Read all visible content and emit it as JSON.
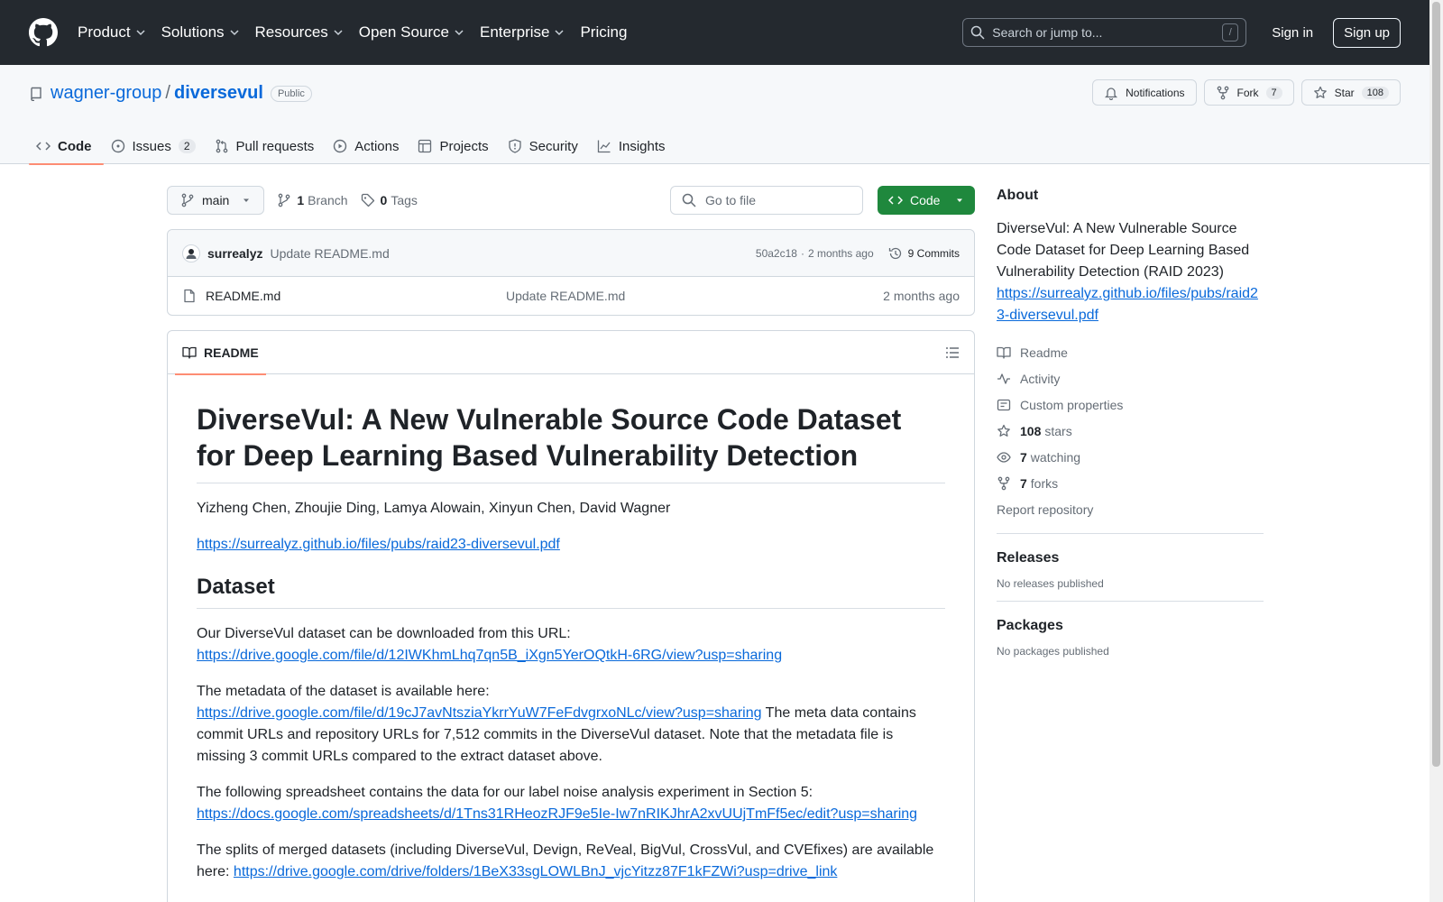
{
  "header": {
    "nav": [
      {
        "label": "Product",
        "has_menu": true
      },
      {
        "label": "Solutions",
        "has_menu": true
      },
      {
        "label": "Resources",
        "has_menu": true
      },
      {
        "label": "Open Source",
        "has_menu": true
      },
      {
        "label": "Enterprise",
        "has_menu": true
      },
      {
        "label": "Pricing",
        "has_menu": false
      }
    ],
    "search_placeholder": "Search or jump to...",
    "search_key": "/",
    "sign_in": "Sign in",
    "sign_up": "Sign up"
  },
  "repo": {
    "owner": "wagner-group",
    "separator": "/",
    "name": "diversevul",
    "visibility": "Public",
    "notifications_label": "Notifications",
    "fork_label": "Fork",
    "fork_count": "7",
    "star_label": "Star",
    "star_count": "108"
  },
  "tabs": [
    {
      "label": "Code",
      "icon": "code-icon",
      "active": true,
      "count": ""
    },
    {
      "label": "Issues",
      "icon": "issue-icon",
      "active": false,
      "count": "2"
    },
    {
      "label": "Pull requests",
      "icon": "pull-request-icon",
      "active": false,
      "count": ""
    },
    {
      "label": "Actions",
      "icon": "play-icon",
      "active": false,
      "count": ""
    },
    {
      "label": "Projects",
      "icon": "table-icon",
      "active": false,
      "count": ""
    },
    {
      "label": "Security",
      "icon": "shield-icon",
      "active": false,
      "count": ""
    },
    {
      "label": "Insights",
      "icon": "graph-icon",
      "active": false,
      "count": ""
    }
  ],
  "toolbar": {
    "branch": "main",
    "branch_count": "1",
    "branch_label": "Branch",
    "tag_count": "0",
    "tag_label": "Tags",
    "goto_placeholder": "Go to file",
    "code_label": "Code"
  },
  "commit": {
    "author": "surrealyz",
    "message": "Update README.md",
    "hash": "50a2c18",
    "dot": "·",
    "time": "2 months ago",
    "commits_label": "9 Commits"
  },
  "files": [
    {
      "name": "README.md",
      "message": "Update README.md",
      "date": "2 months ago"
    }
  ],
  "readme": {
    "tab_label": "README",
    "title": "DiverseVul: A New Vulnerable Source Code Dataset for Deep Learning Based Vulnerability Detection",
    "authors": "Yizheng Chen, Zhoujie Ding, Lamya Alowain, Xinyun Chen, David Wagner",
    "paper_link": "https://surrealyz.github.io/files/pubs/raid23-diversevul.pdf",
    "dataset_heading": "Dataset",
    "p1_text": "Our DiverseVul dataset can be downloaded from this URL:",
    "p1_link": "https://drive.google.com/file/d/12IWKhmLhq7qn5B_iXgn5YerOQtkH-6RG/view?usp=sharing",
    "p2_text": "The metadata of the dataset is available here:",
    "p2_link": "https://drive.google.com/file/d/19cJ7avNtsziaYkrrYuW7FeFdvgrxoNLc/view?usp=sharing",
    "p2_tail": "The meta data contains commit URLs and repository URLs for 7,512 commits in the DiverseVul dataset. Note that the metadata file is missing 3 commit URLs compared to the extract dataset above.",
    "p3_text": "The following spreadsheet contains the data for our label noise analysis experiment in Section 5:",
    "p3_link": "https://docs.google.com/spreadsheets/d/1Tns31RHeozRJF9e5Ie-Iw7nRIKJhrA2xvUUjTmFf5ec/edit?usp=sharing",
    "p4_text": "The splits of merged datasets (including DiverseVul, Devign, ReVeal, BigVul, CrossVul, and CVEfixes) are available here:",
    "p4_link": "https://drive.google.com/drive/folders/1BeX33sgLOWLBnJ_vjcYitzz87F1kFZWi?usp=drive_link"
  },
  "about": {
    "heading": "About",
    "description": "DiverseVul: A New Vulnerable Source Code Dataset for Deep Learning Based Vulnerability Detection (RAID 2023)",
    "link": "https://surrealyz.github.io/files/pubs/raid23-diversevul.pdf",
    "readme": "Readme",
    "activity": "Activity",
    "custom_properties": "Custom properties",
    "stars_count": "108",
    "stars_label": "stars",
    "watching_count": "7",
    "watching_label": "watching",
    "forks_count": "7",
    "forks_label": "forks",
    "report": "Report repository"
  },
  "releases": {
    "heading": "Releases",
    "empty": "No releases published"
  },
  "packages": {
    "heading": "Packages",
    "empty": "No packages published"
  }
}
